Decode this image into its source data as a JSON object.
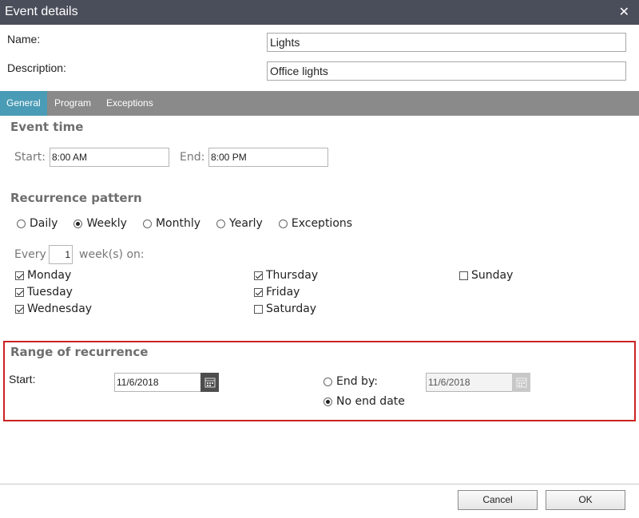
{
  "dialog": {
    "title": "Event details",
    "close_icon": "close-icon"
  },
  "fields": {
    "name_label": "Name:",
    "name_value": "Lights",
    "description_label": "Description:",
    "description_value": "Office lights"
  },
  "tabs": [
    {
      "label": "General",
      "active": true
    },
    {
      "label": "Program",
      "active": false
    },
    {
      "label": "Exceptions",
      "active": false
    }
  ],
  "event_time": {
    "title": "Event time",
    "start_label": "Start:",
    "start_value": "8:00 AM",
    "end_label": "End:",
    "end_value": "8:00 PM"
  },
  "recurrence": {
    "title": "Recurrence pattern",
    "options": [
      {
        "label": "Daily",
        "selected": false
      },
      {
        "label": "Weekly",
        "selected": true
      },
      {
        "label": "Monthly",
        "selected": false
      },
      {
        "label": "Yearly",
        "selected": false
      },
      {
        "label": "Exceptions",
        "selected": false
      }
    ],
    "every_label": "Every",
    "every_value": "1",
    "weeks_on_label": "week(s) on:",
    "days": [
      {
        "label": "Monday",
        "checked": true
      },
      {
        "label": "Tuesday",
        "checked": true
      },
      {
        "label": "Wednesday",
        "checked": true
      },
      {
        "label": "Thursday",
        "checked": true
      },
      {
        "label": "Friday",
        "checked": true
      },
      {
        "label": "Saturday",
        "checked": false
      },
      {
        "label": "Sunday",
        "checked": false
      }
    ]
  },
  "range": {
    "title": "Range of recurrence",
    "start_label": "Start:",
    "start_value": "11/6/2018",
    "end_by_label": "End by:",
    "end_by_value": "11/6/2018",
    "end_by_selected": false,
    "no_end_label": "No end date",
    "no_end_selected": true,
    "calendar_icon": "calendar-icon"
  },
  "footer": {
    "cancel_label": "Cancel",
    "ok_label": "OK"
  },
  "colors": {
    "titlebar": "#4a4e5a",
    "tabbar": "#8a8a8a",
    "active_tab": "#4a9bb5",
    "highlight_border": "#cc2222"
  }
}
